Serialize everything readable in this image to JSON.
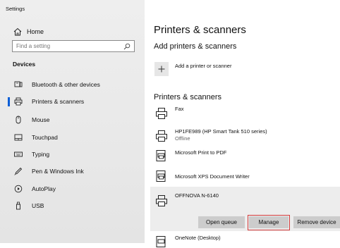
{
  "window": {
    "title": "Settings"
  },
  "sidebar": {
    "home_label": "Home",
    "search_placeholder": "Find a setting",
    "section_label": "Devices",
    "items": [
      {
        "label": "Bluetooth & other devices",
        "icon": "bluetooth-devices-icon"
      },
      {
        "label": "Printers & scanners",
        "icon": "printer-icon",
        "active": true
      },
      {
        "label": "Mouse",
        "icon": "mouse-icon"
      },
      {
        "label": "Touchpad",
        "icon": "touchpad-icon"
      },
      {
        "label": "Typing",
        "icon": "keyboard-icon"
      },
      {
        "label": "Pen & Windows Ink",
        "icon": "pen-icon"
      },
      {
        "label": "AutoPlay",
        "icon": "autoplay-icon"
      },
      {
        "label": "USB",
        "icon": "usb-icon"
      }
    ]
  },
  "main": {
    "title": "Printers & scanners",
    "add_section_title": "Add printers & scanners",
    "add_button_label": "Add a printer or scanner",
    "list_section_title": "Printers & scanners",
    "printers": [
      {
        "name": "Fax",
        "status": ""
      },
      {
        "name": "HP1FE989 (HP Smart Tank 510 series)",
        "status": "Offline"
      },
      {
        "name": "Microsoft Print to PDF",
        "status": ""
      },
      {
        "name": "Microsoft XPS Document Writer",
        "status": ""
      },
      {
        "name": "OFFNOVA N-6140",
        "status": ""
      },
      {
        "name": "OneNote (Desktop)",
        "status": ""
      }
    ],
    "actions": {
      "open_queue": "Open queue",
      "manage": "Manage",
      "remove_device": "Remove device"
    }
  },
  "colors": {
    "accent": "#0a5ed7",
    "highlight": "#d33a3a",
    "sidebar_bg": "#ececec",
    "button_bg": "#cccccc"
  }
}
